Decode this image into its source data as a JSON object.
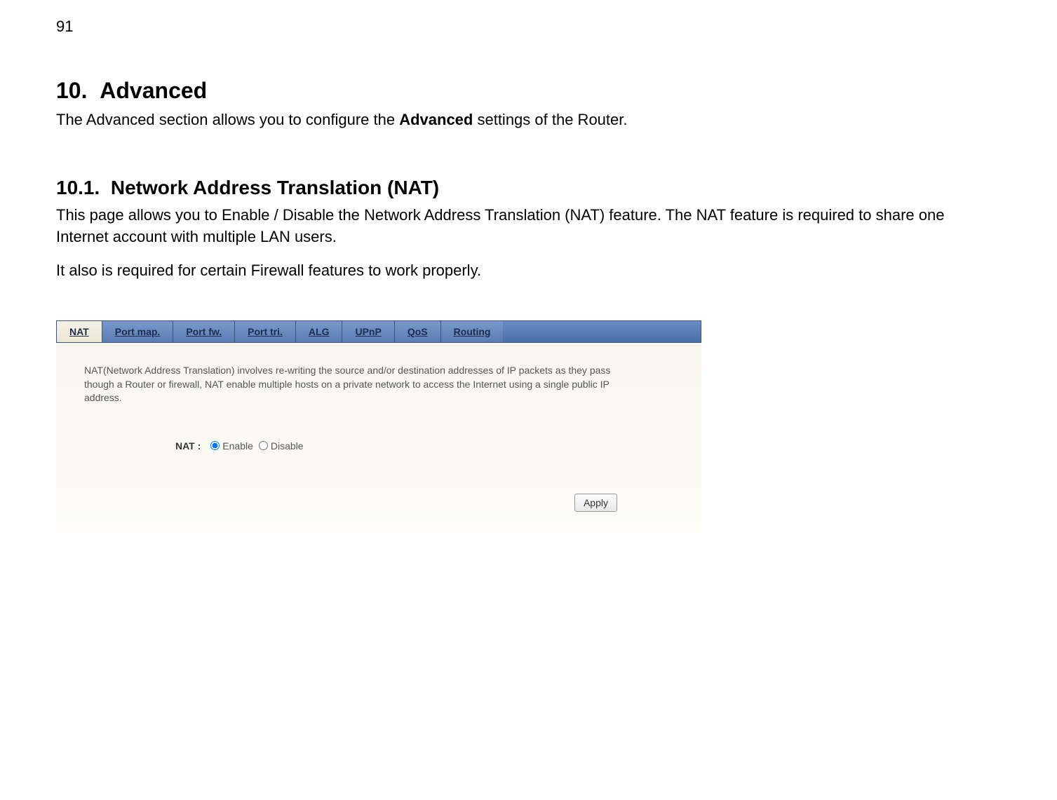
{
  "page_number": "91",
  "heading1_num": "10.",
  "heading1_text": "Advanced",
  "intro_pre": "The Advanced section allows you to configure the ",
  "intro_bold": "Advanced",
  "intro_post": " settings of the Router.",
  "heading2_num": "10.1.",
  "heading2_text": "Network Address Translation (NAT)",
  "para1": "This page allows you to Enable / Disable the Network Address Translation (NAT) feature. The NAT feature is required to share one Internet account with multiple LAN users.",
  "para2": "It also is required for certain Firewall features to work properly.",
  "tabs": {
    "nat": "NAT",
    "portmap": "Port map.",
    "portfw": "Port fw.",
    "porttri": "Port tri.",
    "alg": "ALG",
    "upnp": "UPnP",
    "qos": "QoS",
    "routing": "Routing"
  },
  "panel": {
    "desc": "NAT(Network Address Translation) involves re-writing the source and/or destination addresses of IP packets as they pass though a Router or firewall, NAT enable multiple hosts on a private network to access the Internet using a single public IP address.",
    "nat_label": "NAT :",
    "enable_label": "Enable",
    "disable_label": "Disable",
    "apply_label": "Apply"
  }
}
